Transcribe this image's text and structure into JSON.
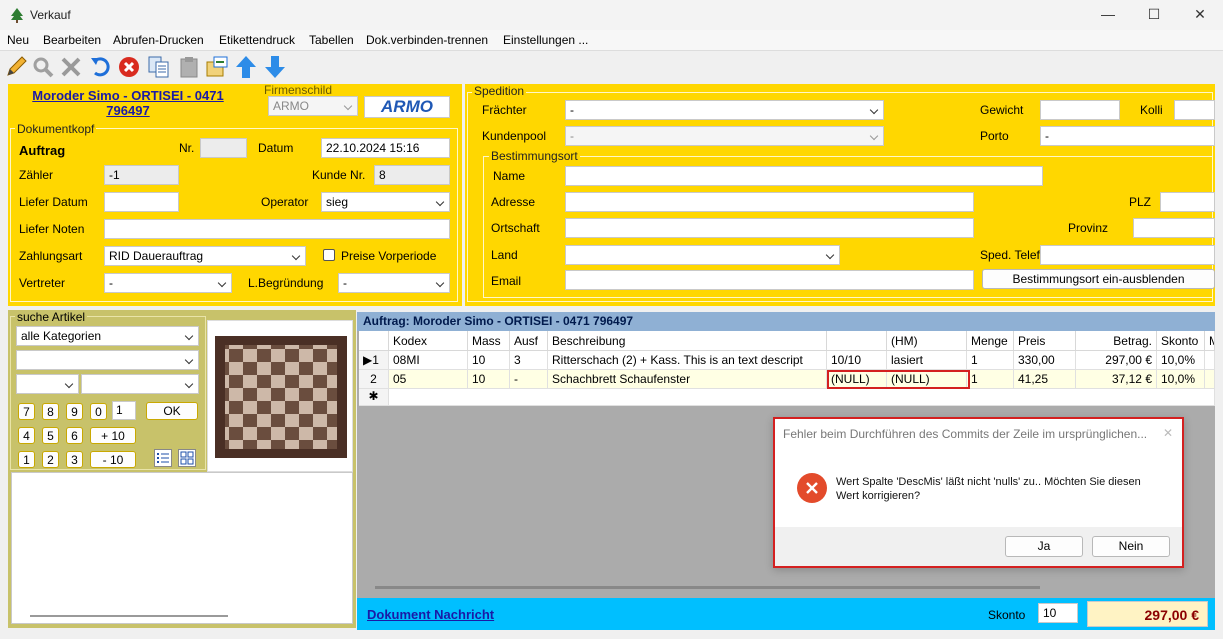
{
  "window": {
    "title": "Verkauf",
    "min": "—",
    "max": "☐",
    "close": "✕"
  },
  "menu": [
    "Neu",
    "Bearbeiten",
    "Abrufen-Drucken",
    "Etikettendruck",
    "Tabellen",
    "Dok.verbinden-trennen",
    "Einstellungen ..."
  ],
  "toolbar_icons": [
    "pencil-icon",
    "search-icon",
    "delete-x-icon",
    "undo-icon",
    "cancel-icon",
    "copy-icon",
    "paste-icon",
    "export-icon",
    "arrow-up-icon",
    "arrow-down-icon"
  ],
  "customer": {
    "name_line1": "Moroder Simo - ORTISEI - 0471",
    "name_line2": "796497"
  },
  "firmenschild": {
    "title": "Firmenschild",
    "value": "ARMO",
    "logo": "ARMO"
  },
  "dokumentkopf": {
    "title": "Dokumentkopf",
    "doc_type": "Auftrag",
    "nr_label": "Nr.",
    "nr_value": "",
    "datum_label": "Datum",
    "datum_value": "22.10.2024 15:16",
    "zaehler_label": "Zähler",
    "zaehler_value": "-1",
    "kunde_nr_label": "Kunde Nr.",
    "kunde_nr_value": "8",
    "liefer_datum_label": "Liefer Datum",
    "liefer_datum_value": "",
    "operator_label": "Operator",
    "operator_value": "sieg",
    "liefer_noten_label": "Liefer Noten",
    "liefer_noten_value": "",
    "zahlungsart_label": "Zahlungsart",
    "zahlungsart_value": "RID Dauerauftrag",
    "preise_label": "Preise Vorperiode",
    "vertreter_label": "Vertreter",
    "vertreter_value": "-",
    "begruendung_label": "L.Begründung",
    "begruendung_value": "-"
  },
  "spedition": {
    "title": "Spedition",
    "fraechter_label": "Frächter",
    "fraechter_value": "-",
    "kundenpool_label": "Kundenpool",
    "kundenpool_value": "-",
    "gewicht_label": "Gewicht",
    "gewicht_value": "",
    "kolli_label": "Kolli",
    "kolli_value": "",
    "porto_label": "Porto",
    "porto_value": "-",
    "bestimmungsort_title": "Bestimmungsort",
    "name_label": "Name",
    "adresse_label": "Adresse",
    "plz_label": "PLZ",
    "ortschaft_label": "Ortschaft",
    "provinz_label": "Provinz",
    "land_label": "Land",
    "sped_telefon_label": "Sped. Telefon",
    "email_label": "Email",
    "toggle_button": "Bestimmungsort ein-ausblenden"
  },
  "article_search": {
    "title": "suche Artikel",
    "category_value": "alle Kategorien",
    "qty_value": "1",
    "ok_label": "OK",
    "keys": [
      "7",
      "8",
      "9",
      "0",
      "4",
      "5",
      "6",
      "+ 10",
      "1",
      "2",
      "3",
      "- 10"
    ]
  },
  "grid": {
    "title": "Auftrag: Moroder Simo - ORTISEI - 0471 796497",
    "columns": [
      "Kodex",
      "Mass",
      "Ausf",
      "Beschreibung",
      "",
      "(HM)",
      "Menge",
      "Preis",
      "Betrag.",
      "Skonto",
      "M"
    ],
    "rows": [
      {
        "indicator": "▶1",
        "cells": [
          "08MI",
          "10",
          "3",
          "Ritterschach (2) + Kass. This is an text descript",
          "10/10",
          "lasiert",
          "1",
          "330,00",
          "297,00 €",
          "10,0%",
          ""
        ]
      },
      {
        "indicator": "2",
        "cells": [
          "05",
          "10",
          "-",
          "Schachbrett Schaufenster",
          "(NULL)",
          "(NULL)",
          "1",
          "41,25",
          "37,12 €",
          "10,0%",
          ""
        ]
      }
    ],
    "new_row_indicator": "✱"
  },
  "footer": {
    "dokument_nachricht": "Dokument Nachricht",
    "skonto_label": "Skonto",
    "skonto_value": "10",
    "total": "297,00 €"
  },
  "dialog": {
    "title": "Fehler beim Durchführen des Commits der Zeile im ursprünglichen...",
    "close": "✕",
    "message_line1": "Wert Spalte 'DescMis' läßt nicht 'nulls' zu.. Möchten Sie diesen",
    "message_line2": "Wert korrigieren?",
    "yes": "Ja",
    "no": "Nein"
  },
  "colors": {
    "panel": "#ffd700",
    "grid_header": "#8fb0d4",
    "footer": "#00bfff",
    "total_bg": "#fff3c4",
    "error": "#e34b2b"
  }
}
